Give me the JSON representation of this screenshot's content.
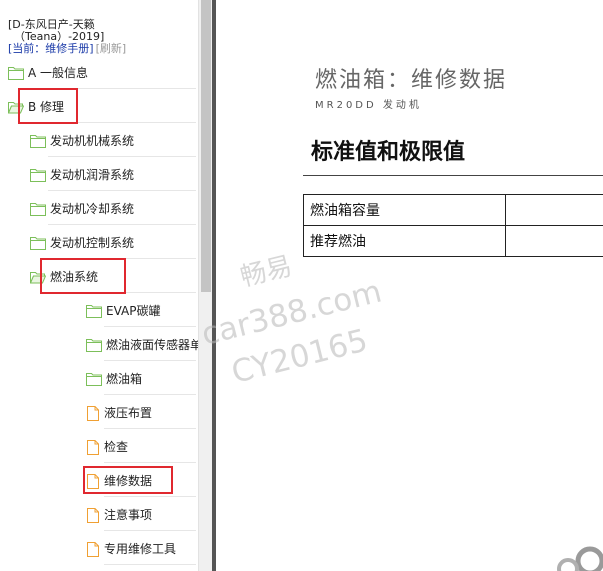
{
  "header": {
    "line1": "[D-东风日产-天籁",
    "line2": "（Teana）-2019]",
    "current_label": "[当前：维修手册]",
    "refresh_label": "[刷新]"
  },
  "tree": [
    {
      "label": "A 一般信息",
      "type": "folder",
      "level": 0
    },
    {
      "label": "B 修理",
      "type": "folder-open",
      "level": 0,
      "highlight": true
    },
    {
      "label": "发动机机械系统",
      "type": "folder",
      "level": 1
    },
    {
      "label": "发动机润滑系统",
      "type": "folder",
      "level": 1
    },
    {
      "label": "发动机冷却系统",
      "type": "folder",
      "level": 1
    },
    {
      "label": "发动机控制系统",
      "type": "folder",
      "level": 1
    },
    {
      "label": "燃油系统",
      "type": "folder-open",
      "level": 1,
      "highlight": true
    },
    {
      "label": "EVAP碳罐",
      "type": "folder",
      "level": 2
    },
    {
      "label": "燃油液面传感器单元",
      "type": "folder",
      "level": 2
    },
    {
      "label": "燃油箱",
      "type": "folder",
      "level": 2
    },
    {
      "label": "液压布置",
      "type": "page",
      "level": 2
    },
    {
      "label": "检查",
      "type": "page",
      "level": 2
    },
    {
      "label": "维修数据",
      "type": "page",
      "level": 2,
      "highlight": true
    },
    {
      "label": "注意事项",
      "type": "page",
      "level": 2
    },
    {
      "label": "专用维修工具",
      "type": "page",
      "level": 2
    }
  ],
  "document": {
    "title": "燃油箱：维修数据",
    "engine": "MR20DD 发动机",
    "section": "标准值和极限值",
    "table": [
      [
        "燃油箱容量",
        ""
      ],
      [
        "推荐燃油",
        ""
      ]
    ]
  },
  "watermark": {
    "line1": "畅易",
    "line2": "car388.com",
    "line3": "CY20165"
  },
  "colors": {
    "highlight": "#e0282f",
    "folder": "#7cbf5a",
    "page": "#f0a033",
    "current_link": "#1a3aa8"
  }
}
